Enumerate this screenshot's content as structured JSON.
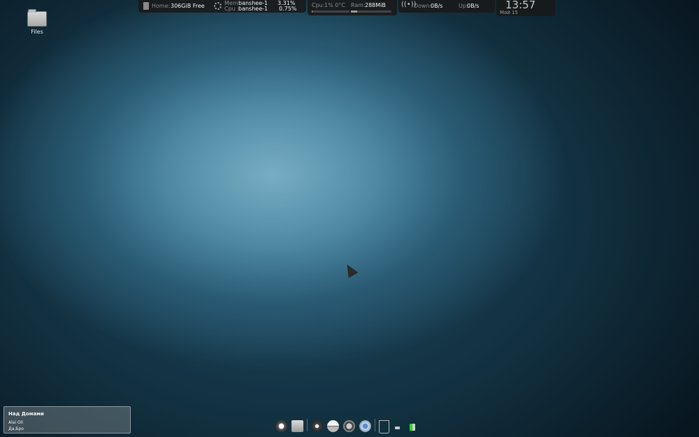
{
  "desktop": {
    "files_icon_label": "Files"
  },
  "top_panel": {
    "home_label": "Home:",
    "home_value": "306GiB Free",
    "mem_label": "Mem:",
    "mem_process": "banshee-1",
    "mem_value": "3.31%",
    "cpu_label": "Cpu :",
    "cpu_process": "banshee-1",
    "cpu_value": "0.75%",
    "cpu_usage_label": "Cpu:",
    "cpu_usage_value": "1% 0°C",
    "ram_label": "Ram:",
    "ram_value": "288MiB",
    "down_label": "Down:",
    "down_value": "0B/s",
    "up_label": "Up:",
    "up_value": "0B/s",
    "clock_time": "13:57",
    "clock_date": "Май 15"
  },
  "notification": {
    "title": "Над Домами",
    "line1": "Alai Oli",
    "line2": "Да,Бро"
  },
  "dock": {
    "icons": [
      "app-launcher-icon",
      "files-icon",
      "banshee-icon",
      "ubuntu-one-icon",
      "maps-icon",
      "chromium-icon",
      "trash-icon",
      "battery-icon",
      "network-icon"
    ]
  }
}
